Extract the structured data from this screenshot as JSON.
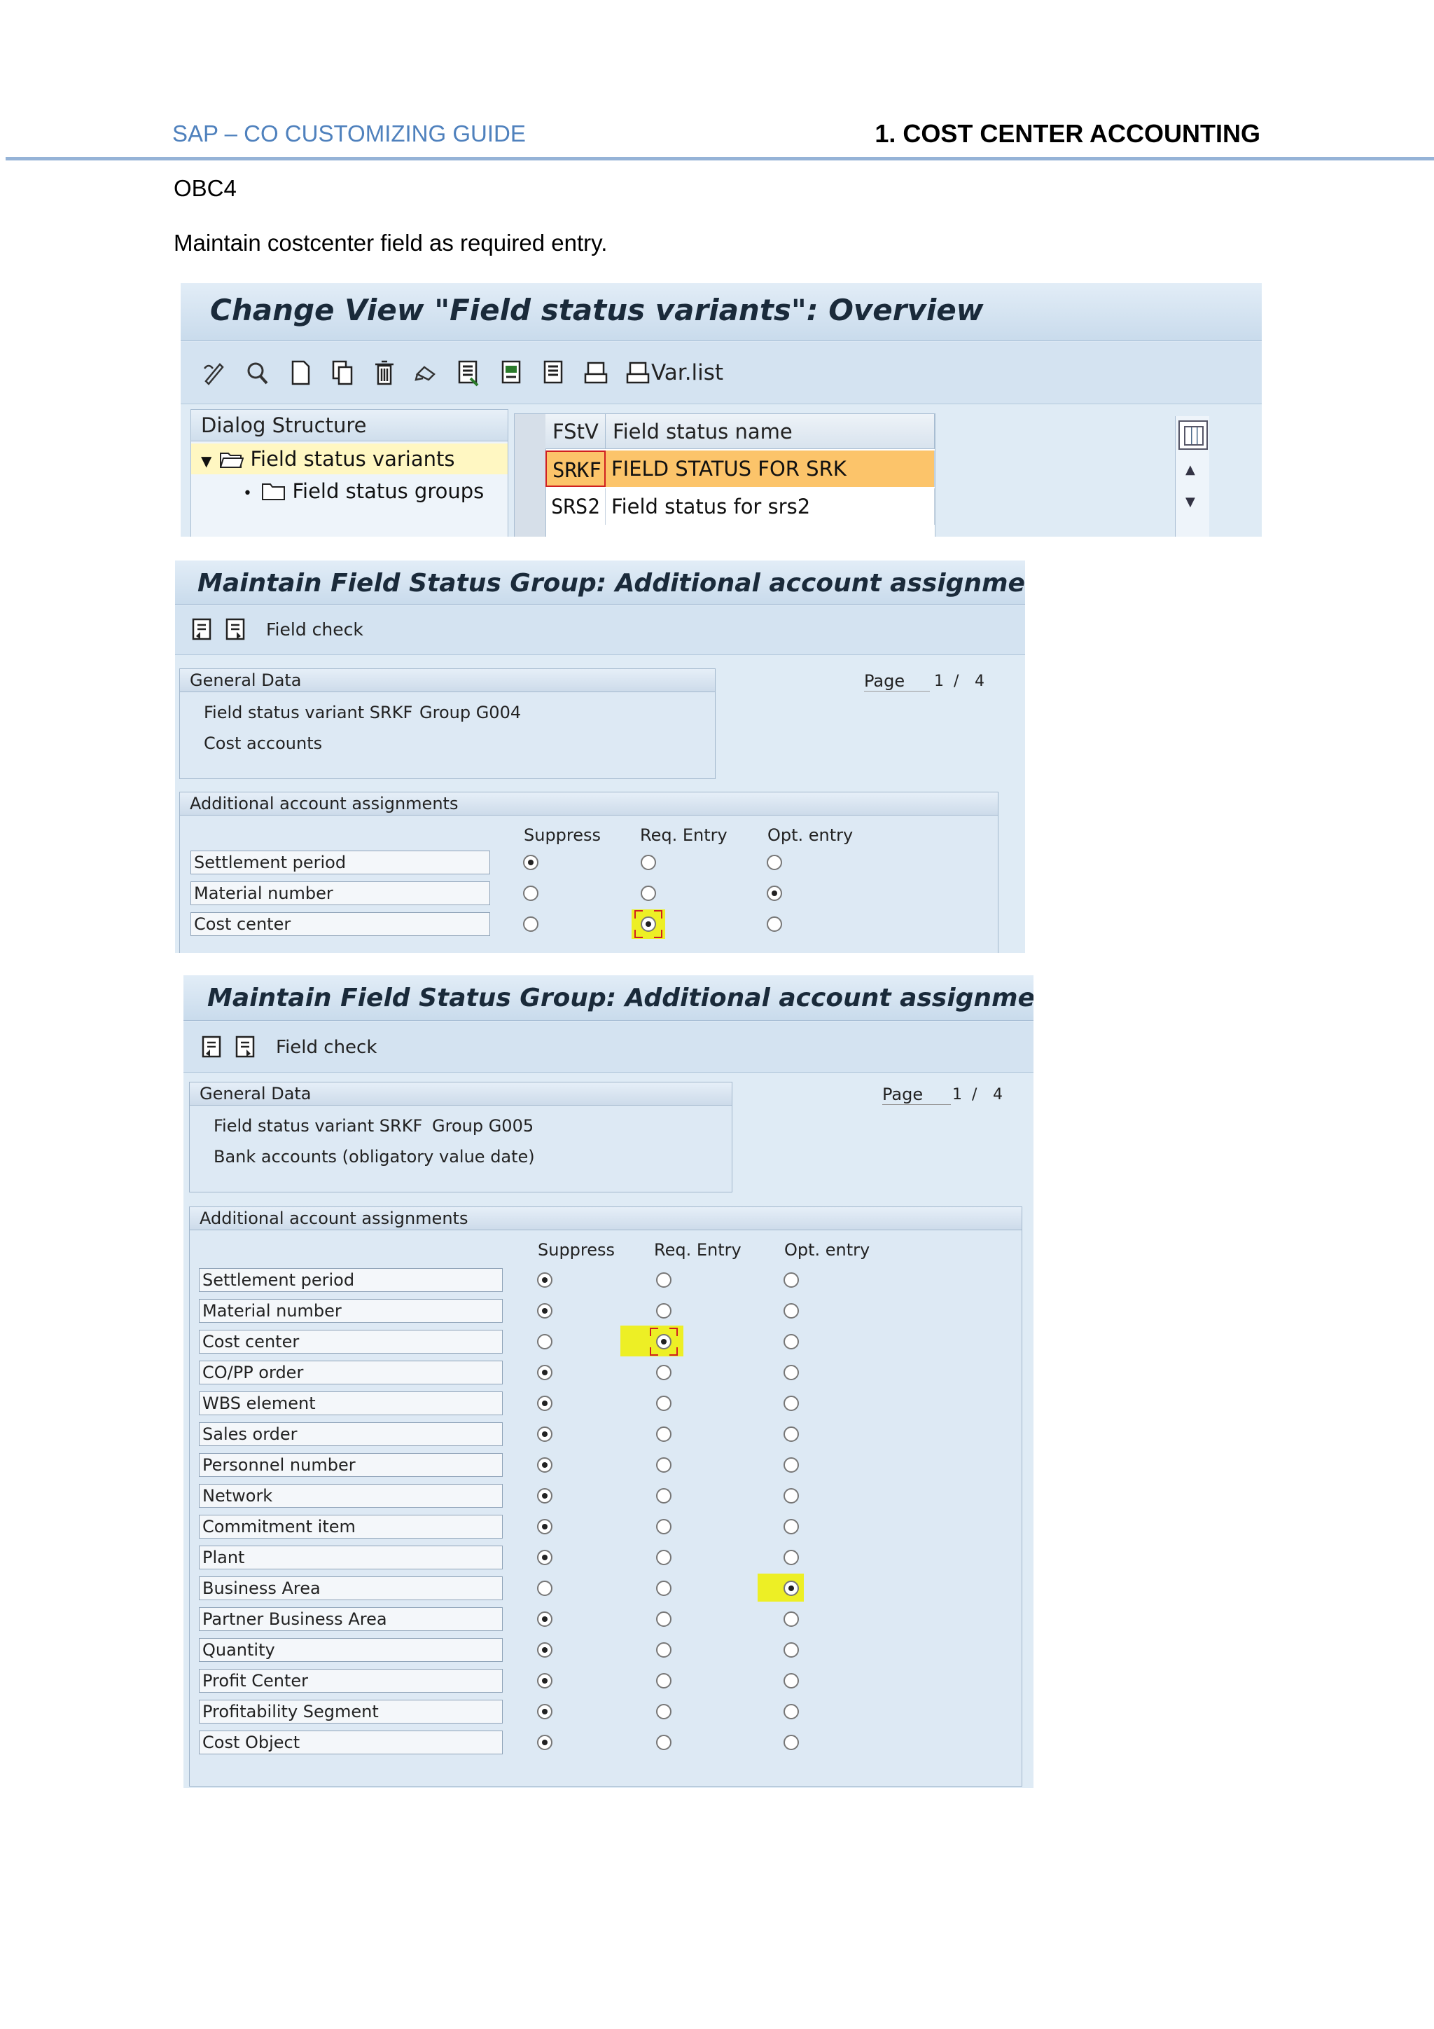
{
  "document": {
    "header_left": "SAP – CO CUSTOMIZING GUIDE",
    "header_right": "1. COST CENTER ACCOUNTING",
    "tcode": "OBC4",
    "instruction": "Maintain costcenter field as required entry."
  },
  "screen1": {
    "title": "Change View \"Field status variants\": Overview",
    "toolbar_varlist": "Var.list",
    "dialog_structure": {
      "heading": "Dialog Structure",
      "items": [
        {
          "label": "Field status variants",
          "selected": true,
          "expanded": true
        },
        {
          "label": "Field status groups",
          "selected": false
        }
      ]
    },
    "table": {
      "columns": [
        "FStV",
        "Field status name"
      ],
      "rows": [
        {
          "code": "SRKF",
          "name": "FIELD STATUS FOR SRK",
          "highlighted": true
        },
        {
          "code": "SRS2",
          "name": "Field status for srs2",
          "highlighted": false
        }
      ]
    }
  },
  "screen2": {
    "title": "Maintain Field Status Group: Additional account assignments",
    "toolbar_label": "Field check",
    "general_data": {
      "heading": "General Data",
      "variant_label": "Field status variant SRKF",
      "group_label": "Group G004",
      "group_text": "Cost accounts"
    },
    "page": {
      "label": "Page",
      "current": "1",
      "sep": "/",
      "total": "4"
    },
    "section_heading": "Additional account assignments",
    "columns": [
      "Suppress",
      "Req. Entry",
      "Opt. entry"
    ],
    "fields": [
      {
        "label": "Settlement period",
        "selected": 0
      },
      {
        "label": "Material number",
        "selected": 2
      },
      {
        "label": "Cost center",
        "selected": 1
      }
    ]
  },
  "screen3": {
    "title": "Maintain Field Status Group: Additional account assignments",
    "toolbar_label": "Field check",
    "general_data": {
      "heading": "General Data",
      "variant_label": "Field status variant SRKF",
      "group_label": "Group G005",
      "group_text": "Bank accounts (obligatory value date)"
    },
    "page": {
      "label": "Page",
      "current": "1",
      "sep": "/",
      "total": "4"
    },
    "section_heading": "Additional account assignments",
    "columns": [
      "Suppress",
      "Req. Entry",
      "Opt. entry"
    ],
    "fields": [
      {
        "label": "Settlement period",
        "selected": 0
      },
      {
        "label": "Material number",
        "selected": 0
      },
      {
        "label": "Cost center",
        "selected": 1
      },
      {
        "label": "CO/PP order",
        "selected": 0
      },
      {
        "label": "WBS element",
        "selected": 0
      },
      {
        "label": "Sales order",
        "selected": 0
      },
      {
        "label": "Personnel number",
        "selected": 0
      },
      {
        "label": "Network",
        "selected": 0
      },
      {
        "label": "Commitment item",
        "selected": 0
      },
      {
        "label": "Plant",
        "selected": 0
      },
      {
        "label": "Business Area",
        "selected": 2
      },
      {
        "label": "Partner Business Area",
        "selected": 0
      },
      {
        "label": "Quantity",
        "selected": 0
      },
      {
        "label": "Profit Center",
        "selected": 0
      },
      {
        "label": "Profitability Segment",
        "selected": 0
      },
      {
        "label": "Cost Object",
        "selected": 0
      }
    ]
  },
  "colors": {
    "header_blue": "#4f81bd",
    "row_highlight": "#fcc46a",
    "marker_yellow": "#f0f000"
  }
}
